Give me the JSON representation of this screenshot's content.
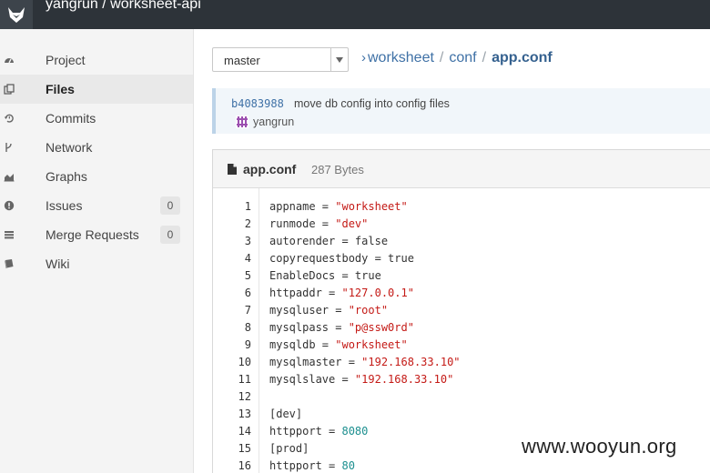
{
  "header": {
    "title": "yangrun / worksheet-api"
  },
  "sidebar": {
    "items": [
      {
        "label": "Project",
        "icon": "dashboard-icon"
      },
      {
        "label": "Files",
        "icon": "files-icon",
        "active": true
      },
      {
        "label": "Commits",
        "icon": "history-icon"
      },
      {
        "label": "Network",
        "icon": "branch-icon"
      },
      {
        "label": "Graphs",
        "icon": "area-chart-icon"
      },
      {
        "label": "Issues",
        "icon": "exclamation-circle-icon",
        "badge": "0"
      },
      {
        "label": "Merge Requests",
        "icon": "tasks-icon",
        "badge": "0"
      },
      {
        "label": "Wiki",
        "icon": "book-icon"
      }
    ]
  },
  "branch": {
    "selected": "master"
  },
  "breadcrumb": {
    "parts": [
      "worksheet",
      "conf"
    ],
    "current": "app.conf",
    "separator": "/"
  },
  "commit": {
    "sha": "b4083988",
    "message": "move db config into config files",
    "author": "yangrun"
  },
  "file": {
    "name": "app.conf",
    "size": "287 Bytes",
    "lines": [
      {
        "n": "1",
        "key": "appname = ",
        "val": "\"worksheet\"",
        "type": "str"
      },
      {
        "n": "2",
        "key": "runmode = ",
        "val": "\"dev\"",
        "type": "str"
      },
      {
        "n": "3",
        "key": "autorender = false",
        "val": "",
        "type": "plain"
      },
      {
        "n": "4",
        "key": "copyrequestbody = true",
        "val": "",
        "type": "plain"
      },
      {
        "n": "5",
        "key": "EnableDocs = true",
        "val": "",
        "type": "plain"
      },
      {
        "n": "6",
        "key": "httpaddr = ",
        "val": "\"127.0.0.1\"",
        "type": "str"
      },
      {
        "n": "7",
        "key": "mysqluser = ",
        "val": "\"root\"",
        "type": "str"
      },
      {
        "n": "8",
        "key": "mysqlpass = ",
        "val": "\"p@ssw0rd\"",
        "type": "str"
      },
      {
        "n": "9",
        "key": "mysqldb = ",
        "val": "\"worksheet\"",
        "type": "str"
      },
      {
        "n": "10",
        "key": "mysqlmaster = ",
        "val": "\"192.168.33.10\"",
        "type": "str"
      },
      {
        "n": "11",
        "key": "mysqlslave = ",
        "val": "\"192.168.33.10\"",
        "type": "str"
      },
      {
        "n": "12",
        "key": "",
        "val": "",
        "type": "plain"
      },
      {
        "n": "13",
        "key": "[dev]",
        "val": "",
        "type": "plain"
      },
      {
        "n": "14",
        "key": "httpport = ",
        "val": "8080",
        "type": "num"
      },
      {
        "n": "15",
        "key": "[prod]",
        "val": "",
        "type": "plain"
      },
      {
        "n": "16",
        "key": "httpport = ",
        "val": "80",
        "type": "num"
      }
    ]
  },
  "watermark": "www.wooyun.org",
  "colors": {
    "header_bg": "#2d3339",
    "link": "#3f71a6",
    "string": "#c41a16",
    "number": "#1c8f8f"
  }
}
